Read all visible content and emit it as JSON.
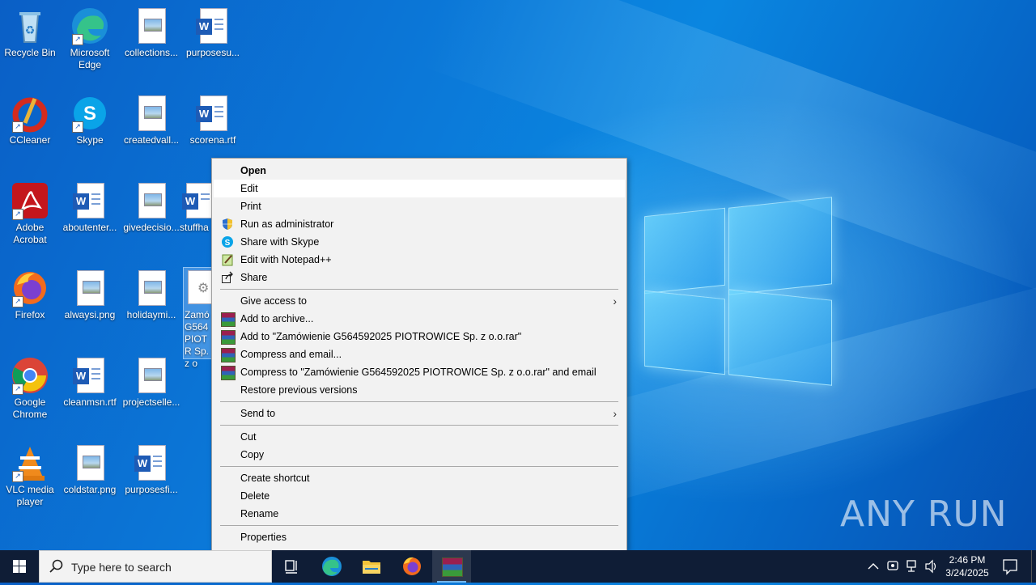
{
  "desktop": {
    "icons": [
      {
        "label": "Recycle Bin",
        "icon": "recycle-bin-icon"
      },
      {
        "label": "Microsoft Edge",
        "icon": "edge-icon"
      },
      {
        "label": "collections...",
        "icon": "image-file-icon"
      },
      {
        "label": "purposesu...",
        "icon": "word-doc-icon"
      },
      {
        "label": "CCleaner",
        "icon": "ccleaner-icon"
      },
      {
        "label": "Skype",
        "icon": "skype-icon"
      },
      {
        "label": "createdvall...",
        "icon": "image-file-icon"
      },
      {
        "label": "scorena.rtf",
        "icon": "word-doc-icon"
      },
      {
        "label": "Adobe Acrobat",
        "icon": "acrobat-icon"
      },
      {
        "label": "aboutenter...",
        "icon": "word-doc-icon"
      },
      {
        "label": "givedecisio...",
        "icon": "image-file-icon"
      },
      {
        "label": "stuffha",
        "icon": "word-doc-icon"
      },
      {
        "label": "Firefox",
        "icon": "firefox-icon"
      },
      {
        "label": "alwaysi.png",
        "icon": "image-file-icon"
      },
      {
        "label": "holidaymi...",
        "icon": "image-file-icon"
      },
      {
        "label": "Zamó G564 PIOTR Sp. z o",
        "icon": "executable-file-icon"
      },
      {
        "label": "Google Chrome",
        "icon": "chrome-icon"
      },
      {
        "label": "cleanmsn.rtf",
        "icon": "word-doc-icon"
      },
      {
        "label": "projectselle...",
        "icon": "image-file-icon"
      },
      {
        "label": "VLC media player",
        "icon": "vlc-icon"
      },
      {
        "label": "coldstar.png",
        "icon": "image-file-icon"
      },
      {
        "label": "purposesfi...",
        "icon": "word-doc-icon"
      }
    ]
  },
  "context_menu": {
    "items": [
      {
        "label": "Open",
        "icon": "",
        "bold": true
      },
      {
        "label": "Edit",
        "icon": "",
        "highlighted": true
      },
      {
        "label": "Print",
        "icon": ""
      },
      {
        "label": "Run as administrator",
        "icon": "uac-shield-icon"
      },
      {
        "label": "Share with Skype",
        "icon": "skype-icon"
      },
      {
        "label": "Edit with Notepad++",
        "icon": "notepadpp-icon"
      },
      {
        "label": "Share",
        "icon": "share-icon"
      },
      {
        "label": "Give access to",
        "icon": "",
        "submenu": true
      },
      {
        "label": "Add to archive...",
        "icon": "winrar-icon"
      },
      {
        "label": "Add to \"Zamówienie G564592025 PIOTROWICE Sp. z o.o.rar\"",
        "icon": "winrar-icon"
      },
      {
        "label": "Compress and email...",
        "icon": "winrar-icon"
      },
      {
        "label": "Compress to \"Zamówienie G564592025 PIOTROWICE Sp. z o.o.rar\" and email",
        "icon": "winrar-icon"
      },
      {
        "label": "Restore previous versions",
        "icon": ""
      },
      {
        "label": "Send to",
        "icon": "",
        "submenu": true
      },
      {
        "label": "Cut",
        "icon": ""
      },
      {
        "label": "Copy",
        "icon": ""
      },
      {
        "label": "Create shortcut",
        "icon": ""
      },
      {
        "label": "Delete",
        "icon": ""
      },
      {
        "label": "Rename",
        "icon": ""
      },
      {
        "label": "Properties",
        "icon": ""
      }
    ],
    "submenu_arrow": "›"
  },
  "taskbar": {
    "search_placeholder": "Type here to search",
    "pinned": [
      "task-view-icon",
      "edge-icon",
      "file-explorer-icon",
      "firefox-icon",
      "winrar-icon"
    ],
    "clock_time": "2:46 PM",
    "clock_date": "3/24/2025"
  },
  "watermark": "ANY RUN"
}
